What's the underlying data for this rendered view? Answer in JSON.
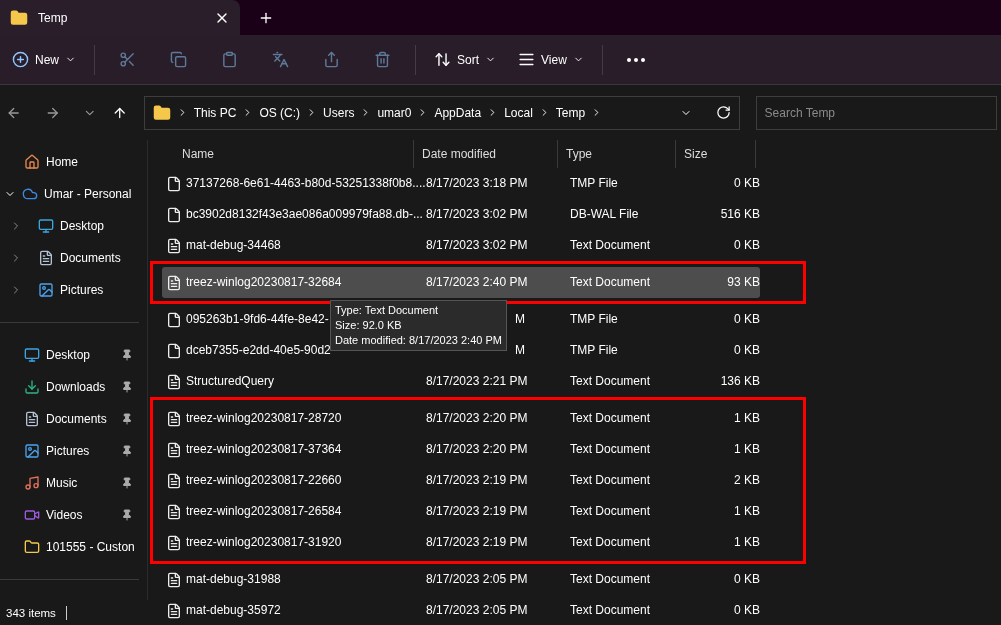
{
  "window": {
    "tab_title": "Temp"
  },
  "toolbar": [
    {
      "kind": "new",
      "label": "New",
      "disabled": false
    },
    {
      "kind": "cut",
      "disabled": true
    },
    {
      "kind": "copy",
      "disabled": true
    },
    {
      "kind": "paste",
      "disabled": true
    },
    {
      "kind": "rename",
      "disabled": true
    },
    {
      "kind": "share",
      "disabled": true
    },
    {
      "kind": "delete",
      "disabled": true
    },
    {
      "kind": "sort",
      "label": "Sort",
      "disabled": false
    },
    {
      "kind": "view",
      "label": "View",
      "disabled": false
    },
    {
      "kind": "more",
      "disabled": false
    }
  ],
  "breadcrumb": [
    "This PC",
    "OS (C:)",
    "Users",
    "umar0",
    "AppData",
    "Local",
    "Temp"
  ],
  "search": {
    "placeholder": "Search Temp"
  },
  "sidebar": {
    "items": [
      {
        "kind": "home",
        "label": "Home"
      },
      {
        "kind": "cloud",
        "label": "Umar - Personal",
        "expanded": true,
        "children": [
          {
            "kind": "desktop",
            "label": "Desktop",
            "expanded": false
          },
          {
            "kind": "documents",
            "label": "Documents",
            "expanded": false
          },
          {
            "kind": "pictures",
            "label": "Pictures",
            "expanded": false
          }
        ]
      }
    ],
    "pinned": [
      {
        "kind": "desktop",
        "label": "Desktop",
        "pinned": true
      },
      {
        "kind": "downloads",
        "label": "Downloads",
        "pinned": true
      },
      {
        "kind": "documents",
        "label": "Documents",
        "pinned": true
      },
      {
        "kind": "pictures",
        "label": "Pictures",
        "pinned": true
      },
      {
        "kind": "music",
        "label": "Music",
        "pinned": true
      },
      {
        "kind": "videos",
        "label": "Videos",
        "pinned": true
      },
      {
        "kind": "folder",
        "label": "101555 - Custon",
        "pinned": false
      }
    ]
  },
  "table": {
    "columns": [
      "Name",
      "Date modified",
      "Type",
      "Size"
    ],
    "rows": [
      {
        "kind": "blank",
        "name": "37137268-6e61-4463-b80d-53251338f0b8....",
        "date": "8/17/2023 3:18 PM",
        "type": "TMP File",
        "size": "0 KB",
        "selected": false,
        "marked": false
      },
      {
        "kind": "blank",
        "name": "bc3902d8132f43e3ae086a009979fa88.db-...",
        "date": "8/17/2023 3:02 PM",
        "type": "DB-WAL File",
        "size": "516 KB",
        "selected": false,
        "marked": false
      },
      {
        "kind": "text",
        "name": "mat-debug-34468",
        "date": "8/17/2023 3:02 PM",
        "type": "Text Document",
        "size": "0 KB",
        "selected": false,
        "marked": false
      },
      {
        "kind": "text",
        "name": "treez-winlog20230817-32684",
        "date": "8/17/2023 2:40 PM",
        "type": "Text Document",
        "size": "93 KB",
        "selected": true,
        "marked": true
      },
      {
        "kind": "blank",
        "name": "095263b1-9fd6-44fe-8e42-",
        "date": "M",
        "type": "TMP File",
        "size": "0 KB",
        "selected": false,
        "marked": false
      },
      {
        "kind": "blank",
        "name": "dceb7355-e2dd-40e5-90d2",
        "date": "M",
        "type": "TMP File",
        "size": "0 KB",
        "selected": false,
        "marked": false
      },
      {
        "kind": "text",
        "name": "StructuredQuery",
        "date": "8/17/2023 2:21 PM",
        "type": "Text Document",
        "size": "136 KB",
        "selected": false,
        "marked": false
      },
      {
        "kind": "text",
        "name": "treez-winlog20230817-28720",
        "date": "8/17/2023 2:20 PM",
        "type": "Text Document",
        "size": "1 KB",
        "selected": false,
        "marked": true
      },
      {
        "kind": "text",
        "name": "treez-winlog20230817-37364",
        "date": "8/17/2023 2:20 PM",
        "type": "Text Document",
        "size": "1 KB",
        "selected": false,
        "marked": true
      },
      {
        "kind": "text",
        "name": "treez-winlog20230817-22660",
        "date": "8/17/2023 2:19 PM",
        "type": "Text Document",
        "size": "2 KB",
        "selected": false,
        "marked": true
      },
      {
        "kind": "text",
        "name": "treez-winlog20230817-26584",
        "date": "8/17/2023 2:19 PM",
        "type": "Text Document",
        "size": "1 KB",
        "selected": false,
        "marked": true
      },
      {
        "kind": "text",
        "name": "treez-winlog20230817-31920",
        "date": "8/17/2023 2:19 PM",
        "type": "Text Document",
        "size": "1 KB",
        "selected": false,
        "marked": true
      },
      {
        "kind": "text",
        "name": "mat-debug-31988",
        "date": "8/17/2023 2:05 PM",
        "type": "Text Document",
        "size": "0 KB",
        "selected": false,
        "marked": false
      },
      {
        "kind": "text",
        "name": "mat-debug-35972",
        "date": "8/17/2023 2:05 PM",
        "type": "Text Document",
        "size": "0 KB",
        "selected": false,
        "marked": false
      }
    ]
  },
  "tooltip": [
    "Type: Text Document",
    "Size: 92.0 KB",
    "Date modified: 8/17/2023 2:40 PM"
  ],
  "status_bar": {
    "count": "343 items"
  }
}
